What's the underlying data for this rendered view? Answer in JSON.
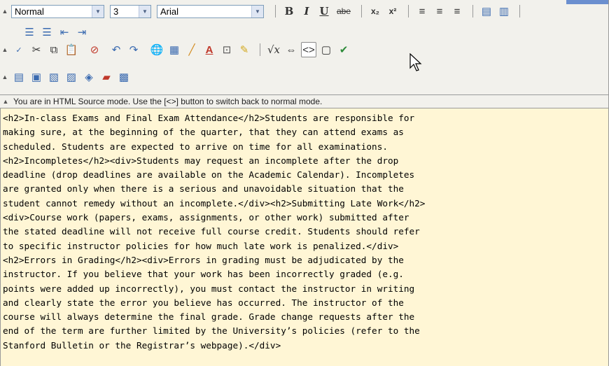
{
  "toolbar": {
    "format_select": "Normal",
    "size_select": "3",
    "font_select": "Arial",
    "bold_label": "B",
    "italic_label": "I",
    "underline_label": "U",
    "strike_label": "abe",
    "subscript_label": "x₂",
    "superscript_label": "x²"
  },
  "status": {
    "message": "You are in HTML Source mode. Use the [<>] button to switch back to normal mode."
  },
  "source_lines": [
    "<h2>In-class Exams and Final Exam Attendance</h2>Students are responsible for",
    "making sure, at the beginning of the quarter, that they can attend exams as",
    "scheduled. Students are expected to arrive on time for all examinations.",
    "<h2>Incompletes</h2><div>Students may request an incomplete after the drop",
    "deadline (drop deadlines are available on the Academic Calendar). Incompletes",
    "are granted only when there is a serious and unavoidable situation that the",
    "student cannot remedy without an incomplete.</div><h2>Submitting Late Work</h2>",
    "<div>Course work (papers, exams, assignments, or other work) submitted after",
    "the stated deadline will not receive full course credit. Students should refer",
    "to specific instructor policies for how much late work is penalized.</div>",
    "<h2>Errors in Grading</h2><div>Errors in grading must be adjudicated by the",
    "instructor. If you believe that your work has been incorrectly graded (e.g.",
    "points were added up incorrectly), you must contact the instructor in writing",
    "and clearly state the error you believe has occurred. The instructor of the",
    "course will always determine the final grade. Grade change requests after the",
    "end of the term are further limited by the University’s policies (refer to the",
    "Stanford Bulletin or the Registrar’s webpage).</div>"
  ]
}
